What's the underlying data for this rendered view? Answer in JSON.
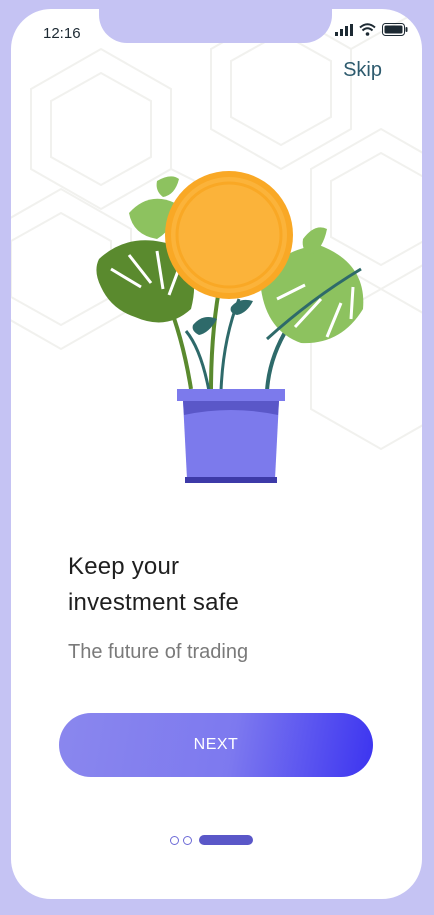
{
  "status_bar": {
    "time": "12:16",
    "icons": [
      "signal-icon",
      "wifi-icon",
      "battery-icon"
    ]
  },
  "header": {
    "skip_label": "Skip"
  },
  "illustration": {
    "name": "coin-plant-pot",
    "colors": {
      "coin": "#fbb33a",
      "pot": "#7c7aec",
      "leaf_dark": "#5a8a2e",
      "leaf_light": "#8dc25f"
    }
  },
  "content": {
    "title_line1": "Keep your",
    "title_line2": "investment safe",
    "subtitle": "The future of trading"
  },
  "actions": {
    "next_label": "NEXT"
  },
  "pagination": {
    "total": 3,
    "active_index": 2
  },
  "colors": {
    "background": "#c5c3f3",
    "accent": "#5a57c8",
    "button_start": "#8a87ee",
    "button_end": "#3c34f0"
  }
}
